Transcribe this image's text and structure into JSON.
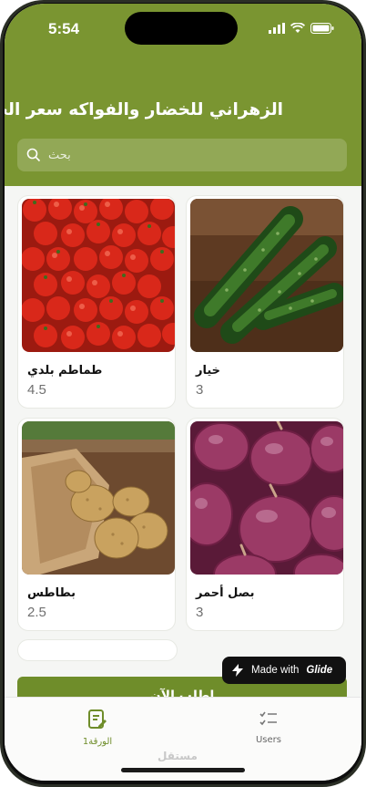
{
  "status_bar": {
    "time": "5:54"
  },
  "header": {
    "title": "الزهراني للخضار والفواكه سعر الجملة"
  },
  "search": {
    "placeholder": "بحث"
  },
  "products": [
    {
      "name": "طماطم بلدي",
      "price": "4.5",
      "image": "tomatoes"
    },
    {
      "name": "خيار",
      "price": "3",
      "image": "cucumbers"
    },
    {
      "name": "بطاطس",
      "price": "2.5",
      "image": "potatoes"
    },
    {
      "name": "بصل أحمر",
      "price": "3",
      "image": "red-onions"
    }
  ],
  "order_button": {
    "label": "اطلب الآن"
  },
  "glide_badge": {
    "prefix": "Made with",
    "brand": "Glide"
  },
  "tabs": [
    {
      "label": "الورقة1",
      "icon": "document-edit-icon",
      "active": true
    },
    {
      "label": "Users",
      "icon": "checklist-icon",
      "active": false
    }
  ],
  "watermark": "مستقل",
  "colors": {
    "header": "#7a9531",
    "active_tab": "#6f8d2a",
    "button": "#6f8d2a"
  }
}
